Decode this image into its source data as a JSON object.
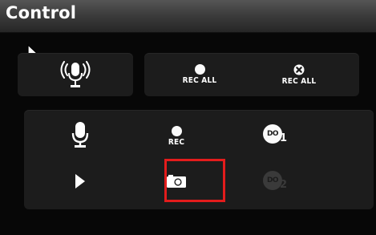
{
  "header": {
    "title": "Control"
  },
  "buttons": {
    "talk": {
      "icon": "wireless-microphone-icon"
    },
    "rec_all": {
      "label": "REC ALL",
      "icon": "record-dot-icon"
    },
    "stop_rec_all": {
      "label": "REC ALL",
      "icon": "stop-x-icon"
    },
    "microphone": {
      "icon": "microphone-icon"
    },
    "rec": {
      "label": "REC",
      "icon": "record-dot-icon"
    },
    "do1": {
      "label": "DO",
      "sub": "1",
      "icon": "digital-output-icon"
    },
    "play": {
      "icon": "play-icon"
    },
    "snapshot": {
      "icon": "camera-icon"
    },
    "do2": {
      "label": "DO",
      "sub": "2",
      "icon": "digital-output-icon",
      "state": "disabled"
    }
  },
  "colors": {
    "highlight": "#e31c1c",
    "icon": "#ffffff",
    "disabled_icon": "#3a3a3a"
  }
}
